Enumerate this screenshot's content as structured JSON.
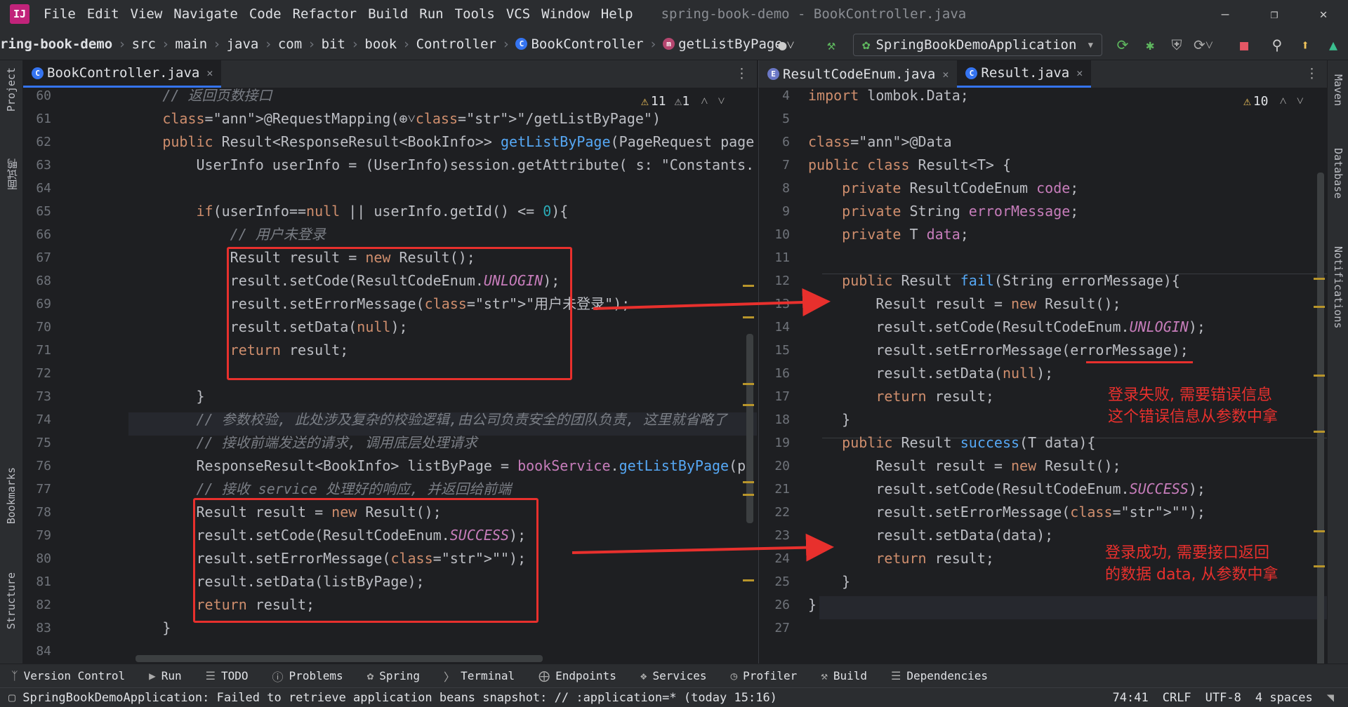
{
  "menubar": {
    "items": [
      "File",
      "Edit",
      "View",
      "Navigate",
      "Code",
      "Refactor",
      "Build",
      "Run",
      "Tools",
      "VCS",
      "Window",
      "Help"
    ],
    "title": "spring-book-demo - BookController.java"
  },
  "breadcrumb": [
    "ring-book-demo",
    "src",
    "main",
    "java",
    "com",
    "bit",
    "book",
    "Controller",
    "BookController",
    "getListByPage"
  ],
  "run_config": "SpringBookDemoApplication",
  "left_tabs": [
    {
      "label": "BookController.java",
      "active": true
    }
  ],
  "right_tabs": [
    {
      "label": "ResultCodeEnum.java",
      "active": false
    },
    {
      "label": "Result.java",
      "active": true
    }
  ],
  "left_inspection": {
    "warnings": "11",
    "weak": "1"
  },
  "right_inspection": {
    "warnings": "10"
  },
  "left_sidebar": [
    "Project",
    "面试鸭",
    "Bookmarks",
    "Structure"
  ],
  "right_sidebar": [
    "Maven",
    "Database",
    "Notifications"
  ],
  "left_code": [
    {
      "n": "60",
      "t": "        // 返回页数接口"
    },
    {
      "n": "61",
      "t": "        @RequestMapping(⊕˅\"/getListByPage\")"
    },
    {
      "n": "62",
      "t": "        public Result<ResponseResult<BookInfo>> getListByPage(PageRequest page"
    },
    {
      "n": "63",
      "t": "            UserInfo userInfo = (UserInfo)session.getAttribute( s: \"Constants."
    },
    {
      "n": "64",
      "t": ""
    },
    {
      "n": "65",
      "t": "            if(userInfo==null || userInfo.getId() <= 0){"
    },
    {
      "n": "66",
      "t": "                // 用户未登录"
    },
    {
      "n": "67",
      "t": "                Result result = new Result();"
    },
    {
      "n": "68",
      "t": "                result.setCode(ResultCodeEnum.UNLOGIN);"
    },
    {
      "n": "69",
      "t": "                result.setErrorMessage(\"用户未登录\");"
    },
    {
      "n": "70",
      "t": "                result.setData(null);"
    },
    {
      "n": "71",
      "t": "                return result;"
    },
    {
      "n": "72",
      "t": ""
    },
    {
      "n": "73",
      "t": "            }"
    },
    {
      "n": "74",
      "t": "            // 参数校验, 此处涉及复杂的校验逻辑,由公司负责安全的团队负责, 这里就省略了"
    },
    {
      "n": "75",
      "t": "            // 接收前端发送的请求, 调用底层处理请求"
    },
    {
      "n": "76",
      "t": "            ResponseResult<BookInfo> listByPage = bookService.getListByPage(pa"
    },
    {
      "n": "77",
      "t": "            // 接收 service 处理好的响应, 并返回给前端"
    },
    {
      "n": "78",
      "t": "            Result result = new Result();"
    },
    {
      "n": "79",
      "t": "            result.setCode(ResultCodeEnum.SUCCESS);"
    },
    {
      "n": "80",
      "t": "            result.setErrorMessage(\"\");"
    },
    {
      "n": "81",
      "t": "            result.setData(listByPage);"
    },
    {
      "n": "82",
      "t": "            return result;"
    },
    {
      "n": "83",
      "t": "        }"
    },
    {
      "n": "84",
      "t": ""
    }
  ],
  "right_code": [
    {
      "n": "4",
      "t": "import lombok.Data;"
    },
    {
      "n": "5",
      "t": ""
    },
    {
      "n": "6",
      "t": "@Data"
    },
    {
      "n": "7",
      "t": "public class Result<T> {"
    },
    {
      "n": "8",
      "t": "    private ResultCodeEnum code;"
    },
    {
      "n": "9",
      "t": "    private String errorMessage;"
    },
    {
      "n": "10",
      "t": "    private T data;"
    },
    {
      "n": "11",
      "t": ""
    },
    {
      "n": "12",
      "t": "    public Result fail(String errorMessage){"
    },
    {
      "n": "13",
      "t": "        Result result = new Result();"
    },
    {
      "n": "14",
      "t": "        result.setCode(ResultCodeEnum.UNLOGIN);"
    },
    {
      "n": "15",
      "t": "        result.setErrorMessage(errorMessage);"
    },
    {
      "n": "16",
      "t": "        result.setData(null);"
    },
    {
      "n": "17",
      "t": "        return result;"
    },
    {
      "n": "18",
      "t": "    }"
    },
    {
      "n": "19",
      "t": "    public Result success(T data){"
    },
    {
      "n": "20",
      "t": "        Result result = new Result();"
    },
    {
      "n": "21",
      "t": "        result.setCode(ResultCodeEnum.SUCCESS);"
    },
    {
      "n": "22",
      "t": "        result.setErrorMessage(\"\");"
    },
    {
      "n": "23",
      "t": "        result.setData(data);"
    },
    {
      "n": "24",
      "t": "        return result;"
    },
    {
      "n": "25",
      "t": "    }"
    },
    {
      "n": "26",
      "t": "}"
    },
    {
      "n": "27",
      "t": ""
    }
  ],
  "annotations": {
    "fail_note": [
      "登录失败, 需要错误信息",
      "这个错误信息从参数中拿"
    ],
    "success_note": [
      "登录成功, 需要接口返回",
      "的数据 data, 从参数中拿"
    ]
  },
  "bottom_tools": [
    "Version Control",
    "Run",
    "TODO",
    "Problems",
    "Spring",
    "Terminal",
    "Endpoints",
    "Services",
    "Profiler",
    "Build",
    "Dependencies"
  ],
  "status": {
    "message": "SpringBookDemoApplication: Failed to retrieve application beans snapshot: // :application=* (today 15:16)",
    "position": "74:41",
    "line_sep": "CRLF",
    "encoding": "UTF-8",
    "indent": "4 spaces"
  },
  "colors": {
    "accent": "#3574f0",
    "annotation_red": "#e8302d",
    "bg": "#1e1f22",
    "panel": "#2b2d30"
  }
}
